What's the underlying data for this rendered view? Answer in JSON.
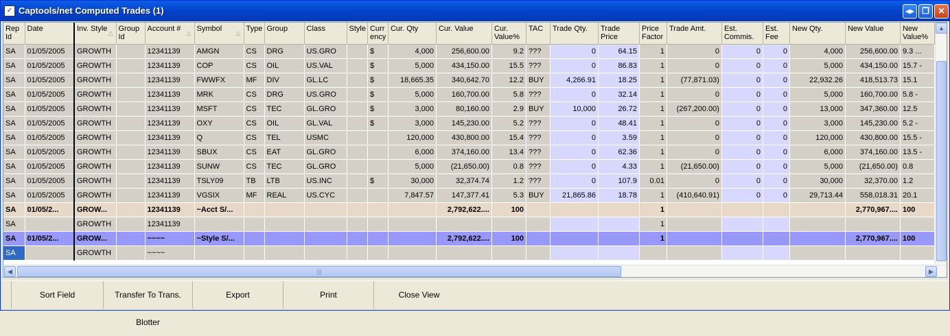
{
  "window": {
    "title": "Captools/net Computed Trades (1)"
  },
  "columns": [
    {
      "label": "Rep Id",
      "sort": false
    },
    {
      "label": "Date",
      "sort": false
    },
    {
      "label": "Inv. Style",
      "sort": true
    },
    {
      "label": "Group Id",
      "sort": false
    },
    {
      "label": "Account #",
      "sort": true
    },
    {
      "label": "Symbol",
      "sort": true
    },
    {
      "label": "Type",
      "sort": false
    },
    {
      "label": "Group",
      "sort": false
    },
    {
      "label": "Class",
      "sort": false
    },
    {
      "label": "Style",
      "sort": false
    },
    {
      "label": "Curr ency",
      "sort": false
    },
    {
      "label": "Cur. Qty",
      "sort": false
    },
    {
      "label": "Cur. Value",
      "sort": false
    },
    {
      "label": "Cur. Value%",
      "sort": false
    },
    {
      "label": "TAC",
      "sort": false
    },
    {
      "label": "Trade Qty.",
      "sort": false
    },
    {
      "label": "Trade Price",
      "sort": false
    },
    {
      "label": "Price Factor",
      "sort": false
    },
    {
      "label": "Trade Amt.",
      "sort": false
    },
    {
      "label": "Est. Commis.",
      "sort": false
    },
    {
      "label": "Est. Fee",
      "sort": false
    },
    {
      "label": "New Qty.",
      "sort": false
    },
    {
      "label": "New Value",
      "sort": false
    },
    {
      "label": "New Value%",
      "sort": false
    }
  ],
  "rows": [
    {
      "kind": "data",
      "cells": [
        "SA",
        "01/05/2005",
        "GROWTH",
        "",
        "12341139",
        "AMGN",
        "CS",
        "DRG",
        "US.GRO",
        "",
        "$",
        "4,000",
        "256,600.00",
        "9.2",
        "???",
        "0",
        "64.15",
        "1",
        "0",
        "0",
        "0",
        "4,000",
        "256,600.00",
        "9.3 ..."
      ]
    },
    {
      "kind": "data",
      "cells": [
        "SA",
        "01/05/2005",
        "GROWTH",
        "",
        "12341139",
        "COP",
        "CS",
        "OIL",
        "US.VAL",
        "",
        "$",
        "5,000",
        "434,150.00",
        "15.5",
        "???",
        "0",
        "86.83",
        "1",
        "0",
        "0",
        "0",
        "5,000",
        "434,150.00",
        "15.7 -"
      ]
    },
    {
      "kind": "data",
      "cells": [
        "SA",
        "01/05/2005",
        "GROWTH",
        "",
        "12341139",
        "FWWFX",
        "MF",
        "DIV",
        "GL.LC",
        "",
        "$",
        "18,665.35",
        "340,642.70",
        "12.2",
        "BUY",
        "4,266.91",
        "18.25",
        "1",
        "(77,871.03)",
        "0",
        "0",
        "22,932.26",
        "418,513.73",
        "15.1"
      ]
    },
    {
      "kind": "data",
      "cells": [
        "SA",
        "01/05/2005",
        "GROWTH",
        "",
        "12341139",
        "MRK",
        "CS",
        "DRG",
        "US.GRO",
        "",
        "$",
        "5,000",
        "160,700.00",
        "5.8",
        "???",
        "0",
        "32.14",
        "1",
        "0",
        "0",
        "0",
        "5,000",
        "160,700.00",
        "5.8 -"
      ]
    },
    {
      "kind": "data",
      "cells": [
        "SA",
        "01/05/2005",
        "GROWTH",
        "",
        "12341139",
        "MSFT",
        "CS",
        "TEC",
        "GL.GRO",
        "",
        "$",
        "3,000",
        "80,160.00",
        "2.9",
        "BUY",
        "10,000",
        "26.72",
        "1",
        "(267,200.00)",
        "0",
        "0",
        "13,000",
        "347,360.00",
        "12.5"
      ]
    },
    {
      "kind": "data",
      "cells": [
        "SA",
        "01/05/2005",
        "GROWTH",
        "",
        "12341139",
        "OXY",
        "CS",
        "OIL",
        "GL.VAL",
        "",
        "$",
        "3,000",
        "145,230.00",
        "5.2",
        "???",
        "0",
        "48.41",
        "1",
        "0",
        "0",
        "0",
        "3,000",
        "145,230.00",
        "5.2 -"
      ]
    },
    {
      "kind": "data",
      "cells": [
        "SA",
        "01/05/2005",
        "GROWTH",
        "",
        "12341139",
        "Q",
        "CS",
        "TEL",
        "USMC",
        "",
        "",
        "120,000",
        "430,800.00",
        "15.4",
        "???",
        "0",
        "3.59",
        "1",
        "0",
        "0",
        "0",
        "120,000",
        "430,800.00",
        "15.5 -"
      ]
    },
    {
      "kind": "data",
      "cells": [
        "SA",
        "01/05/2005",
        "GROWTH",
        "",
        "12341139",
        "SBUX",
        "CS",
        "EAT",
        "GL.GRO",
        "",
        "",
        "6,000",
        "374,160.00",
        "13.4",
        "???",
        "0",
        "62.36",
        "1",
        "0",
        "0",
        "0",
        "6,000",
        "374,160.00",
        "13.5 -"
      ]
    },
    {
      "kind": "data",
      "cells": [
        "SA",
        "01/05/2005",
        "GROWTH",
        "",
        "12341139",
        "SUNW",
        "CS",
        "TEC",
        "GL.GRO",
        "",
        "",
        "5,000",
        "(21,650.00)",
        "0.8",
        "???",
        "0",
        "4.33",
        "1",
        "(21,650.00)",
        "0",
        "0",
        "5,000",
        "(21,650.00)",
        "0.8"
      ]
    },
    {
      "kind": "data",
      "cells": [
        "SA",
        "01/05/2005",
        "GROWTH",
        "",
        "12341139",
        "TSLY09",
        "TB",
        "LTB",
        "US.INC",
        "",
        "$",
        "30,000",
        "32,374.74",
        "1.2",
        "???",
        "0",
        "107.9",
        "0.01",
        "0",
        "0",
        "0",
        "30,000",
        "32,370.00",
        "1.2"
      ]
    },
    {
      "kind": "data",
      "cells": [
        "SA",
        "01/05/2005",
        "GROWTH",
        "",
        "12341139",
        "VGSIX",
        "MF",
        "REAL",
        "US.CYC",
        "",
        "",
        "7,847.57",
        "147,377.41",
        "5.3",
        "BUY",
        "21,865.86",
        "18.78",
        "1",
        "(410,640.91)",
        "0",
        "0",
        "29,713.44",
        "558,018.31",
        "20.1"
      ]
    },
    {
      "kind": "subtotal",
      "cells": [
        "SA",
        "01/05/2...",
        "GROW...",
        "",
        "12341139",
        "~Acct S/...",
        "",
        "",
        "",
        "",
        "",
        "",
        "2,792,622....",
        "100",
        "",
        "",
        "",
        "1",
        "",
        "",
        "",
        "",
        "2,770,967....",
        "100"
      ]
    },
    {
      "kind": "blank",
      "cells": [
        "SA",
        "",
        "GROWTH",
        "",
        "12341139",
        "",
        "",
        "",
        "",
        "",
        "",
        "",
        "",
        "",
        "",
        "",
        "",
        "1",
        "",
        "",
        "",
        "",
        "",
        ""
      ]
    },
    {
      "kind": "styletotal",
      "cells": [
        "SA",
        "01/05/2...",
        "GROW...",
        "",
        "~~~~",
        "~Style S/...",
        "",
        "",
        "",
        "",
        "",
        "",
        "2,792,622....",
        "100",
        "",
        "",
        "",
        "1",
        "",
        "",
        "",
        "",
        "2,770,967....",
        "100"
      ]
    },
    {
      "kind": "sel",
      "cells": [
        "SA",
        "",
        "GROWTH",
        "",
        "~~~~",
        "",
        "",
        "",
        "",
        "",
        "",
        "",
        "",
        "",
        "",
        "",
        "",
        "",
        "",
        "",
        "",
        "",
        "",
        ""
      ]
    }
  ],
  "toolbar": {
    "sort_field": "Sort Field",
    "transfer": "Transfer To Trans. Blotter",
    "export": "Export",
    "print": "Print",
    "close_view": "Close View"
  }
}
